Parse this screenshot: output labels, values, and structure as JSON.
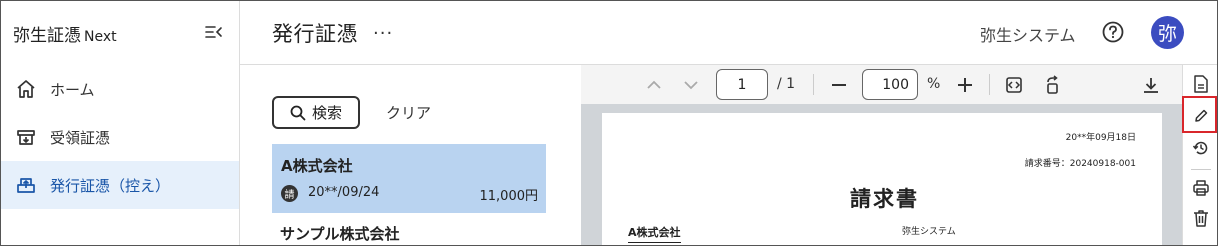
{
  "sidebar": {
    "brand": "弥生証憑",
    "brand_sub": "Next",
    "items": [
      {
        "label": "ホーム",
        "icon": "home-icon"
      },
      {
        "label": "受領証憑",
        "icon": "receive-icon"
      },
      {
        "label": "発行証憑（控え）",
        "icon": "issue-icon",
        "active": true
      }
    ]
  },
  "header": {
    "title": "発行証憑",
    "more": "···",
    "company": "弥生システム",
    "avatar": "弥"
  },
  "list": {
    "search_label": "検索",
    "clear_label": "クリア",
    "selected": {
      "name": "A株式会社",
      "badge": "請",
      "date": "20**/09/24",
      "amount": "11,000円"
    },
    "next_name": "サンプル株式会社"
  },
  "viewer": {
    "page": "1",
    "page_total": "/ 1",
    "zoom": "100",
    "pct": "%"
  },
  "document": {
    "date": "20**年09月18日",
    "number": "請求番号：20240918-001",
    "title": "請求書",
    "to": "A株式会社",
    "from": "弥生システム"
  },
  "colors": {
    "accent": "#3b4cc0",
    "active_nav_bg": "#e6f0fb",
    "selected_card": "#b9d3f0",
    "highlight_box": "#d9262b"
  }
}
